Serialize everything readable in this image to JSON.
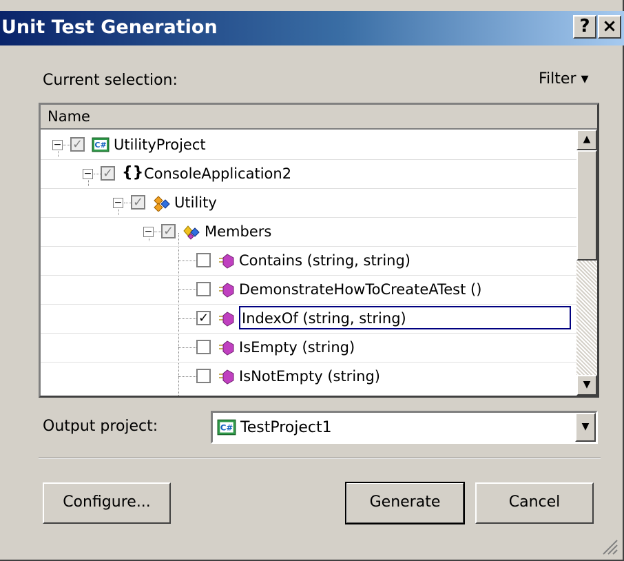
{
  "window": {
    "title": "Unit Test Generation",
    "help_label": "?",
    "close_label": "×"
  },
  "selection_label": "Current selection:",
  "filter_label": "Filter ▾",
  "tree": {
    "column_header": "Name",
    "items": [
      {
        "label": "UtilityProject",
        "icon": "csharp-project-icon",
        "expanded": true,
        "checked": "partial"
      },
      {
        "label": "ConsoleApplication2",
        "icon": "namespace-icon",
        "expanded": true,
        "checked": "partial"
      },
      {
        "label": "Utility",
        "icon": "class-icon",
        "expanded": true,
        "checked": "partial"
      },
      {
        "label": "Members",
        "icon": "members-icon",
        "expanded": true,
        "checked": "partial"
      },
      {
        "label": "Contains (string, string)",
        "icon": "method-icon",
        "checked": "false"
      },
      {
        "label": "DemonstrateHowToCreateATest ()",
        "icon": "method-icon",
        "checked": "false"
      },
      {
        "label": "IndexOf (string, string)",
        "icon": "method-icon",
        "checked": "true",
        "focused": true
      },
      {
        "label": "IsEmpty (string)",
        "icon": "method-icon",
        "checked": "false"
      },
      {
        "label": "IsNotEmpty (string)",
        "icon": "method-icon",
        "checked": "false"
      }
    ]
  },
  "output": {
    "label": "Output project:",
    "value": "TestProject1"
  },
  "buttons": {
    "configure": "Configure...",
    "generate": "Generate",
    "cancel": "Cancel"
  },
  "colors": {
    "title_start": "#0a246a",
    "title_end": "#a6caf0",
    "face": "#d4d0c8",
    "method_icon": "#c040c0"
  }
}
